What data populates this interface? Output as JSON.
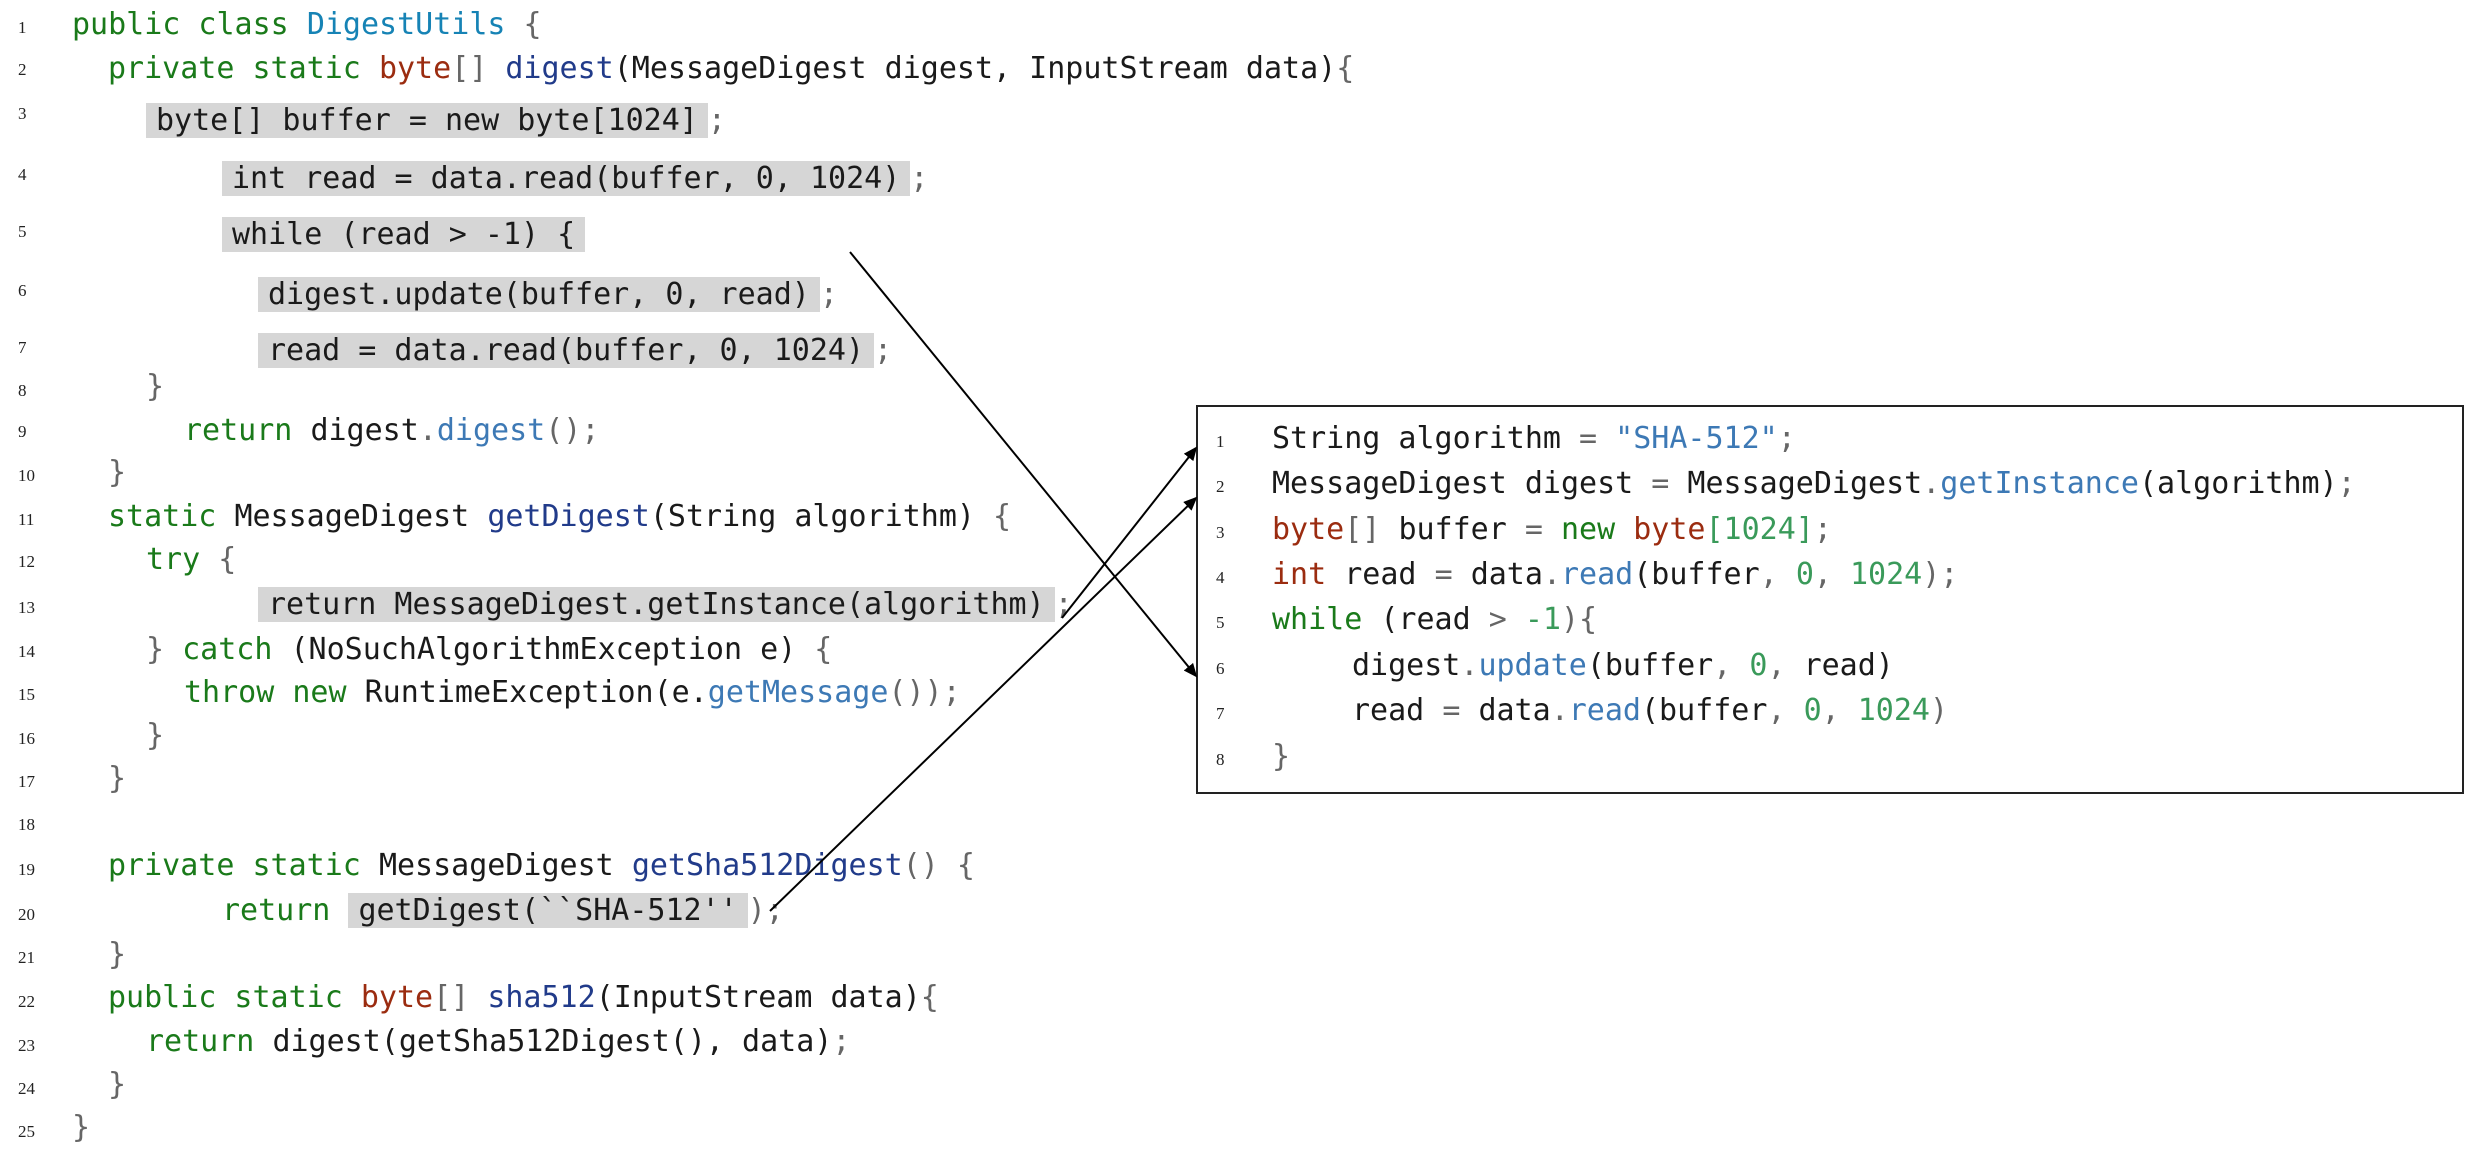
{
  "left_code": {
    "line_numbers": [
      "1",
      "2",
      "3",
      "4",
      "5",
      "6",
      "7",
      "8",
      "9",
      "10",
      "11",
      "12",
      "13",
      "14",
      "15",
      "16",
      "17",
      "18",
      "19",
      "20",
      "21",
      "22",
      "23",
      "24",
      "25"
    ],
    "l1": {
      "kw": "public class ",
      "cl": "DigestUtils",
      "p": " {"
    },
    "l2": {
      "kw": "private static ",
      "ty": "byte",
      "p1": "[] ",
      "fn": "digest",
      "t": "(MessageDigest digest, InputStream data)",
      "p2": "{"
    },
    "l3": {
      "hl": "byte[] buffer = new byte[1024]",
      "p": ";"
    },
    "l4": {
      "hl": "int read = data.read(buffer, 0, 1024)",
      "p": ";"
    },
    "l5": {
      "hl": "while (read > -1) {"
    },
    "l6": {
      "hl": "digest.update(buffer, 0, read)",
      "p": ";"
    },
    "l7": {
      "hl": "read = data.read(buffer, 0, 1024)",
      "p": ";"
    },
    "l8": {
      "p": "}"
    },
    "l9": {
      "kw": "return ",
      "t": "digest",
      "p": ".",
      "mt": "digest",
      "p2": "();"
    },
    "l10": {
      "p": "}"
    },
    "l11": {
      "kw": "static ",
      "t": "MessageDigest ",
      "fn": "getDigest",
      "t2": "(String algorithm) ",
      "p": "{"
    },
    "l12": {
      "kw": "try ",
      "p": "{"
    },
    "l13": {
      "hl": "return MessageDigest.getInstance(algorithm)",
      "p": ";"
    },
    "l14": {
      "p": "} ",
      "kw": "catch ",
      "t": "(NoSuchAlgorithmException e) ",
      "p2": "{"
    },
    "l15": {
      "kw": "throw new ",
      "t": "RuntimeException(e.",
      "mt": "getMessage",
      "p": "());"
    },
    "l16": {
      "p": "}"
    },
    "l17": {
      "p": "}"
    },
    "l19": {
      "kw": "private static ",
      "t": "MessageDigest ",
      "fn": "getSha512Digest",
      "p": "() {"
    },
    "l20": {
      "kw": "return ",
      "hl": "getDigest(``SHA-512''",
      "p": ");"
    },
    "l21": {
      "p": "}"
    },
    "l22": {
      "kw": "public static ",
      "ty": "byte",
      "p1": "[] ",
      "fn": "sha512",
      "t": "(InputStream data)",
      "p2": "{"
    },
    "l23": {
      "kw": "return ",
      "t": "digest(getSha512Digest(), data)",
      "p": ";"
    },
    "l24": {
      "p": "}"
    },
    "l25": {
      "p": "}"
    }
  },
  "right_code": {
    "line_numbers": [
      "1",
      "2",
      "3",
      "4",
      "5",
      "6",
      "7",
      "8"
    ],
    "r1": {
      "t": "String algorithm ",
      "p": "= ",
      "st": "\"SHA-512\"",
      "p2": ";"
    },
    "r2": {
      "t": "MessageDigest digest ",
      "p": "= ",
      "t2": "MessageDigest",
      "p2": ".",
      "mt": "getInstance",
      "t3": "(algorithm)",
      "p3": ";"
    },
    "r3": {
      "ty": "byte",
      "p": "[] ",
      "t": "buffer ",
      "p2": "= ",
      "kw": "new ",
      "ty2": "byte",
      "nm": "[1024]",
      "p3": ";"
    },
    "r4": {
      "ty": "int ",
      "t": "read ",
      "p": "= ",
      "t2": "data",
      "p2": ".",
      "mt": "read",
      "t3": "(buffer",
      "p3": ", ",
      "nm": "0",
      "p4": ", ",
      "nm2": "1024",
      "p5": ");"
    },
    "r5": {
      "kw": "while ",
      "t": "(read ",
      "p": "> ",
      "nm": "-1",
      "p2": "){"
    },
    "r6": {
      "t": "digest",
      "p": ".",
      "mt": "update",
      "t2": "(buffer",
      "p2": ", ",
      "nm": "0",
      "p3": ", ",
      "t3": "read)"
    },
    "r7": {
      "t": "read ",
      "p": "= ",
      "t2": "data",
      "p2": ".",
      "mt": "read",
      "t3": "(buffer",
      "p3": ", ",
      "nm": "0",
      "p4": ", ",
      "nm2": "1024",
      "p5": ")"
    },
    "r8": {
      "p": "}"
    }
  },
  "colors": {
    "keyword": "#1a7a1a",
    "type": "#9b2c10",
    "function": "#213b8a",
    "class": "#1683b5",
    "method": "#3d79b5",
    "number": "#3a9a5a",
    "highlight": "#d6d6d6"
  }
}
